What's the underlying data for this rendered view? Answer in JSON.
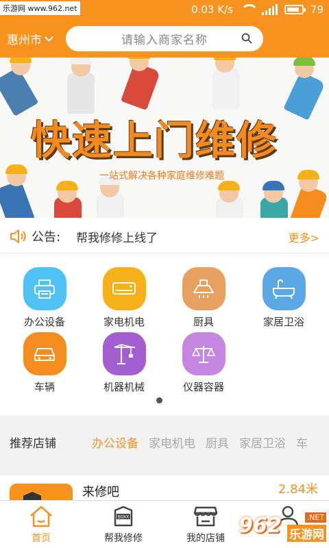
{
  "status_bar": {
    "watermark": "乐游网 www.962.net",
    "speed": "0.03 K/s",
    "battery": "79"
  },
  "header": {
    "city": "惠州市",
    "search_placeholder": "请输入商家名称"
  },
  "banner": {
    "title": "快速上门维修",
    "subtitle": "一站式解决各种家庭维修难题"
  },
  "notice": {
    "label": "公告:",
    "text": "帮我修修上线了",
    "more": "更多>"
  },
  "categories": [
    {
      "label": "办公设备",
      "color": "#4fc1f5",
      "icon": "printer-icon"
    },
    {
      "label": "家电机电",
      "color": "#f6b11a",
      "icon": "air-conditioner-icon"
    },
    {
      "label": "厨具",
      "color": "#e8a060",
      "icon": "range-hood-icon"
    },
    {
      "label": "家居卫浴",
      "color": "#5aa8e6",
      "icon": "bathtub-icon"
    },
    {
      "label": "车辆",
      "color": "#f58c1e",
      "icon": "car-icon"
    },
    {
      "label": "机器机械",
      "color": "#a35ed0",
      "icon": "crane-icon"
    },
    {
      "label": "仪器容器",
      "color": "#c486e0",
      "icon": "scale-icon"
    }
  ],
  "recommend": {
    "title": "推荐店铺",
    "tabs": [
      "办公设备",
      "家电机电",
      "厨具",
      "家居卫浴",
      "车"
    ]
  },
  "shop": {
    "name": "来修吧",
    "distance": "2.84米"
  },
  "tabbar": {
    "items": [
      "首页",
      "帮我修修",
      "我的店铺",
      "我的"
    ]
  },
  "corner_logo": {
    "big": "962",
    "small": ".NET",
    "cn": "乐游网"
  },
  "colors": {
    "accent": "#f7921e"
  }
}
